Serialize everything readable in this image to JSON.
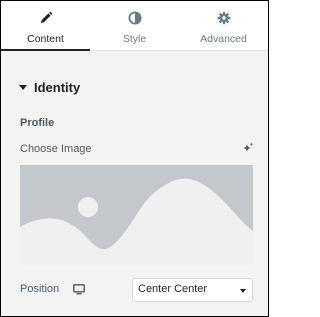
{
  "tabs": [
    {
      "label": "Content",
      "icon": "pencil-icon",
      "active": true
    },
    {
      "label": "Style",
      "icon": "contrast-icon",
      "active": false
    },
    {
      "label": "Advanced",
      "icon": "gear-icon",
      "active": false
    }
  ],
  "section": {
    "title": "Identity",
    "expanded": true
  },
  "profile": {
    "heading": "Profile",
    "choose_image_label": "Choose Image",
    "ai_icon": "sparkle-icon",
    "placeholder_icon": "image-placeholder"
  },
  "position": {
    "label": "Position",
    "device_icon": "desktop-icon",
    "selected": "Center Center"
  },
  "colors": {
    "panel_bg": "#f3f3f4",
    "tab_active": "#1f2124",
    "tab_inactive": "#6d7882",
    "placeholder_bg": "#c4c8cd",
    "placeholder_fg": "#eef0f2"
  }
}
